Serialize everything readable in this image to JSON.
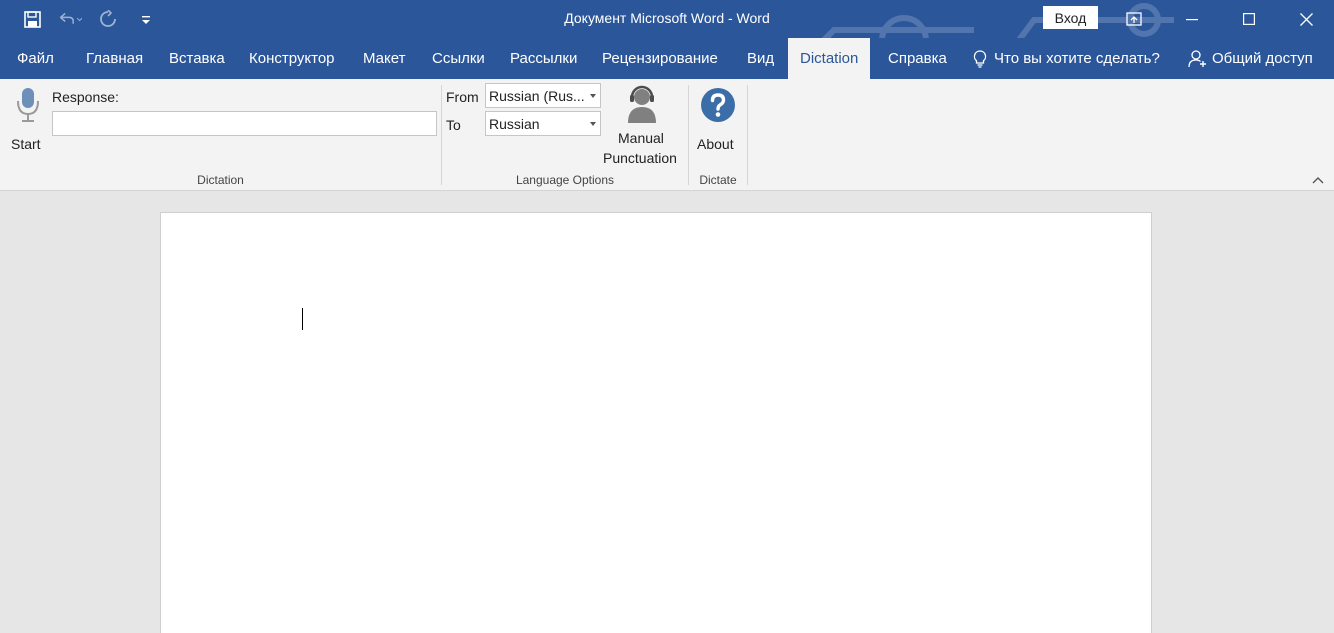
{
  "window": {
    "title": "Документ Microsoft Word  -  Word",
    "sign_in_label": "Вход"
  },
  "tabs": [
    {
      "label": "Файл"
    },
    {
      "label": "Главная"
    },
    {
      "label": "Вставка"
    },
    {
      "label": "Конструктор"
    },
    {
      "label": "Макет"
    },
    {
      "label": "Ссылки"
    },
    {
      "label": "Рассылки"
    },
    {
      "label": "Рецензирование"
    },
    {
      "label": "Вид"
    },
    {
      "label": "Dictation"
    },
    {
      "label": "Справка"
    }
  ],
  "active_tab": "Dictation",
  "tell_me": {
    "label": "Что вы хотите сделать?"
  },
  "share": {
    "label": "Общий доступ"
  },
  "ribbon": {
    "dictation_group": {
      "start_label": "Start",
      "response_label": "Response:",
      "response_value": "",
      "group_label": "Dictation"
    },
    "language_group": {
      "from_label": "From",
      "from_value": "Russian (Rus...",
      "to_label": "To",
      "to_value": "Russian",
      "manual_line1": "Manual",
      "manual_line2": "Punctuation",
      "group_label": "Language Options"
    },
    "dictate_group": {
      "about_label": "About",
      "group_label": "Dictate"
    }
  },
  "colors": {
    "brand": "#2b579a",
    "ribbon_bg": "#f3f3f3",
    "workspace_bg": "#e6e6e6"
  },
  "icons": [
    "save-icon",
    "undo-icon",
    "redo-icon",
    "customize-qat-icon",
    "ribbon-display-options-icon",
    "minimize-icon",
    "maximize-icon",
    "close-icon",
    "lightbulb-icon",
    "person-share-icon",
    "microphone-icon",
    "headset-person-icon",
    "question-icon",
    "collapse-ribbon-icon"
  ]
}
